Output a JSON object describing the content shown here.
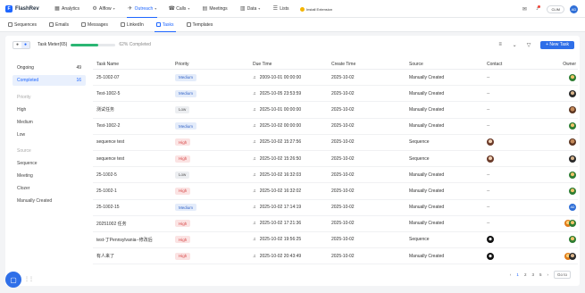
{
  "app": {
    "name": "FlashRev",
    "logo_letter": "F"
  },
  "nav": {
    "items": [
      {
        "label": "Analytics",
        "icon": "chart-icon",
        "dropdown": false,
        "active": false
      },
      {
        "label": "AIflow",
        "icon": "flow-icon",
        "dropdown": true,
        "active": false
      },
      {
        "label": "Outreach",
        "icon": "outreach-icon",
        "dropdown": true,
        "active": true
      },
      {
        "label": "Calls",
        "icon": "phone-icon",
        "dropdown": true,
        "active": false
      },
      {
        "label": "Meetings",
        "icon": "calendar-icon",
        "dropdown": false,
        "active": false
      },
      {
        "label": "Data",
        "icon": "data-icon",
        "dropdown": true,
        "active": false
      },
      {
        "label": "Lists",
        "icon": "list-icon",
        "dropdown": false,
        "active": false
      }
    ],
    "extension_label": "Install Extension",
    "plan_label": "CLIM",
    "user_initials": "AD"
  },
  "subtabs": [
    {
      "label": "Sequences",
      "active": false
    },
    {
      "label": "Emails",
      "active": false
    },
    {
      "label": "Messages",
      "active": false
    },
    {
      "label": "LinkedIn",
      "active": false
    },
    {
      "label": "Tasks",
      "active": true
    },
    {
      "label": "Templates",
      "active": false
    }
  ],
  "toolbar": {
    "meter_label": "Task Meter(65)",
    "meter_fraction": 0.62,
    "meter_pct_text": "62% Completed",
    "new_task_label": "+ New Task"
  },
  "sidebar": {
    "status": [
      {
        "label": "Ongoing",
        "count": "49",
        "active": false
      },
      {
        "label": "Completed",
        "count": "16",
        "active": true
      }
    ],
    "priority_heading": "Priority",
    "priority": [
      "High",
      "Medium",
      "Low"
    ],
    "source_heading": "Source",
    "source": [
      "Sequence",
      "Meeting",
      "Clozer",
      "Manually Created"
    ]
  },
  "table": {
    "columns": [
      "Task Name",
      "Priority",
      "Due Time",
      "Create Time",
      "Source",
      "Contact",
      "Owner"
    ],
    "rows": [
      {
        "name": "25-1002-07",
        "priority": "Medium",
        "due": "2009-10-01 00:00:00",
        "created": "2025-10-02",
        "source": "Manually Created",
        "contact": "--",
        "owner": "green"
      },
      {
        "name": "Test-1002-5",
        "priority": "Medium",
        "due": "2025-10-05 23:53:59",
        "created": "2025-10-02",
        "source": "Manually Created",
        "contact": "--",
        "owner": "dark"
      },
      {
        "name": "测试任务",
        "priority": "Low",
        "due": "2025-10-01 00:00:00",
        "created": "2025-10-02",
        "source": "Manually Created",
        "contact": "--",
        "owner": "brown"
      },
      {
        "name": "Test-1002-2",
        "priority": "Medium",
        "due": "2025-10-02 00:00:00",
        "created": "2025-10-02",
        "source": "Manually Created",
        "contact": "--",
        "owner": "green"
      },
      {
        "name": "sequence test",
        "priority": "High",
        "due": "2025-10-02 15:27:56",
        "created": "2025-10-02",
        "source": "Sequence",
        "contact": "avatar",
        "owner": "brown"
      },
      {
        "name": "sequence test",
        "priority": "High",
        "due": "2025-10-02 15:26:50",
        "created": "2025-10-02",
        "source": "Sequence",
        "contact": "avatar",
        "owner": "dark"
      },
      {
        "name": "25-1002-5",
        "priority": "Low",
        "due": "2025-10-02 16:32:03",
        "created": "2025-10-02",
        "source": "Manually Created",
        "contact": "--",
        "owner": "green"
      },
      {
        "name": "25-1002-1",
        "priority": "High",
        "due": "2025-10-02 16:32:02",
        "created": "2025-10-02",
        "source": "Manually Created",
        "contact": "--",
        "owner": "green"
      },
      {
        "name": "25-1002-15",
        "priority": "Medium",
        "due": "2025-10-02 17:14:19",
        "created": "2025-10-02",
        "source": "Manually Created",
        "contact": "--",
        "owner": "blue"
      },
      {
        "name": "20251002 任务",
        "priority": "High",
        "due": "2025-10-02 17:21:36",
        "created": "2025-10-02",
        "source": "Manually Created",
        "contact": "--",
        "owner": "pair"
      },
      {
        "name": "test-丁Pennsylvania--修改后",
        "priority": "High",
        "due": "2025-10-02 19:56:25",
        "created": "2025-10-02",
        "source": "Sequence",
        "contact": "avatar2",
        "owner": "green"
      },
      {
        "name": "有人来了",
        "priority": "High",
        "due": "2025-10-02 20:43:49",
        "created": "2025-10-02",
        "source": "Manually Created",
        "contact": "avatar2",
        "owner": "pair2"
      }
    ]
  },
  "pager": {
    "pages": [
      "1",
      "2",
      "3",
      "5"
    ],
    "current": "1",
    "goto_label": "Go to"
  }
}
